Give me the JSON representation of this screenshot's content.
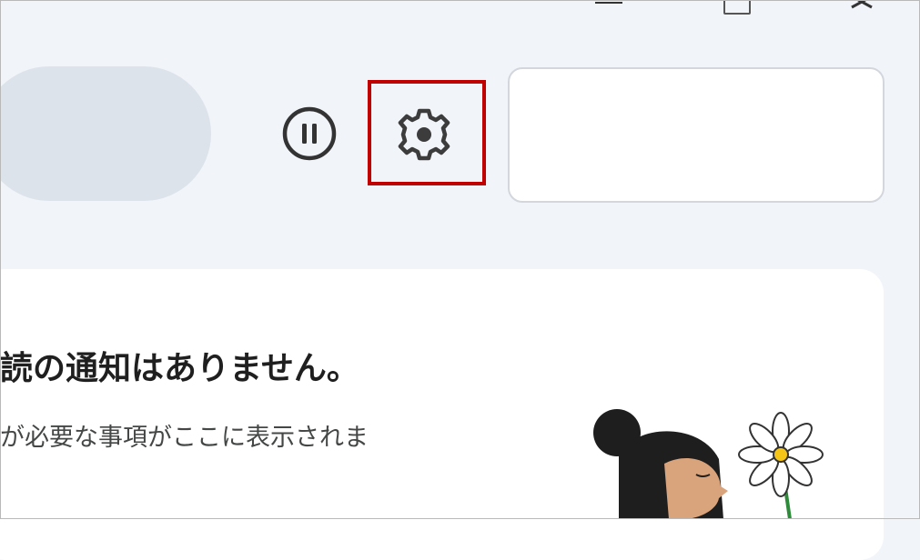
{
  "window": {
    "minimize_icon": "minimize-icon",
    "maximize_icon": "maximize-icon",
    "close_icon": "close-icon"
  },
  "toolbar": {
    "pause_icon": "pause-circle-icon",
    "settings_icon": "gear-icon",
    "highlight_color": "#c00000"
  },
  "empty_state": {
    "title": "読の通知はありません。",
    "subtitle": "が必要な事項がここに表示されま"
  },
  "colors": {
    "background": "#f1f4f9",
    "pill": "#dde3eb",
    "card": "#ffffff",
    "text_primary": "#1f1f1f",
    "text_secondary": "#444746"
  }
}
